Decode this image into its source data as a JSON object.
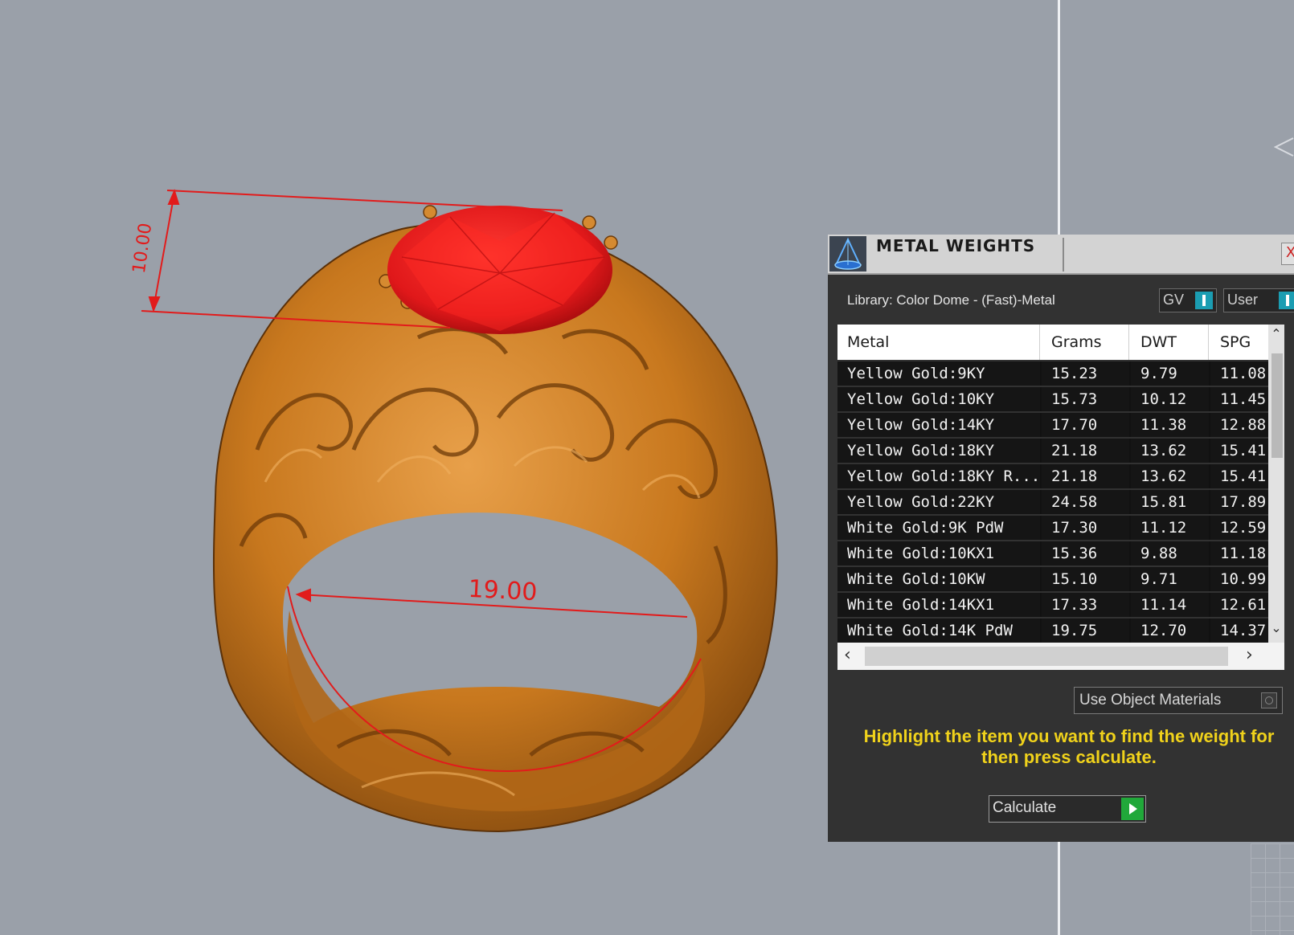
{
  "viewport": {
    "dimension_height": "10.00",
    "dimension_width": "19.00"
  },
  "panel": {
    "title": "METAL WEIGHTS",
    "close_label": "X",
    "library_label": "Library: Color Dome - (Fast)-Metal",
    "toggle_gv": "GV",
    "toggle_user": "User",
    "columns": [
      "Metal",
      "Grams",
      "DWT",
      "SPG"
    ],
    "rows": [
      [
        "Yellow Gold:9KY",
        "15.23",
        "9.79",
        "11.08"
      ],
      [
        "Yellow Gold:10KY",
        "15.73",
        "10.12",
        "11.45"
      ],
      [
        "Yellow Gold:14KY",
        "17.70",
        "11.38",
        "12.88"
      ],
      [
        "Yellow Gold:18KY",
        "21.18",
        "13.62",
        "15.41"
      ],
      [
        "Yellow Gold:18KY R...",
        "21.18",
        "13.62",
        "15.41"
      ],
      [
        "Yellow Gold:22KY",
        "24.58",
        "15.81",
        "17.89"
      ],
      [
        "White Gold:9K PdW",
        "17.30",
        "11.12",
        "12.59"
      ],
      [
        "White Gold:10KX1",
        "15.36",
        "9.88",
        "11.18"
      ],
      [
        "White Gold:10KW",
        "15.10",
        "9.71",
        "10.99"
      ],
      [
        "White Gold:14KX1",
        "17.33",
        "11.14",
        "12.61"
      ],
      [
        "White Gold:14K PdW",
        "19.75",
        "12.70",
        "14.37"
      ]
    ],
    "use_object_materials": "Use Object Materials",
    "hint": "Highlight the item you want to find the weight for then press calculate.",
    "calculate": "Calculate"
  },
  "colors": {
    "ring_gold": "#c8781e",
    "gem_red": "#e0181a",
    "dimension_red": "#e21b1b",
    "hint_yellow": "#f0d21b",
    "toggle_teal": "#1b9db2",
    "calc_green": "#21a83a"
  },
  "icons": {
    "app": "cone-dome-icon",
    "close": "close-icon",
    "calculate": "play-arrow-icon"
  }
}
